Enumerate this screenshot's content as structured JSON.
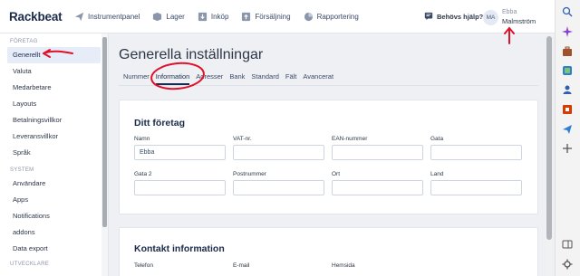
{
  "app": {
    "logo": "Rackbeat"
  },
  "nav": {
    "items": [
      {
        "label": "Instrumentpanel",
        "icon": "paper-plane-icon"
      },
      {
        "label": "Lager",
        "icon": "box-icon"
      },
      {
        "label": "Inköp",
        "icon": "download-icon"
      },
      {
        "label": "Försäljning",
        "icon": "upload-icon"
      },
      {
        "label": "Rapportering",
        "icon": "pie-chart-icon"
      }
    ],
    "help": "Behövs hjälp?",
    "user": {
      "initials": "MA",
      "first_name": "Ebba",
      "last_name": "Malmström"
    }
  },
  "sidebar": {
    "section_company": "FÖRETAG",
    "company_items": [
      "Generellt",
      "Valuta",
      "Medarbetare",
      "Layouts",
      "Betalningsvillkor",
      "Leveransvillkor",
      "Språk"
    ],
    "section_system": "SYSTEM",
    "system_items": [
      "Användare",
      "Apps",
      "Notifications",
      "addons",
      "Data export"
    ],
    "section_dev": "UTVECKLARE"
  },
  "page": {
    "title": "Generella inställningar",
    "tabs": [
      "Nummer",
      "Information",
      "Adresser",
      "Bank",
      "Standard",
      "Fält",
      "Avancerat"
    ],
    "active_tab": "Information"
  },
  "company_card": {
    "title": "Ditt företag",
    "fields": [
      {
        "label": "Namn",
        "value": "Ebba"
      },
      {
        "label": "VAT-nr.",
        "value": ""
      },
      {
        "label": "EAN-nummer",
        "value": ""
      },
      {
        "label": "Gata",
        "value": ""
      },
      {
        "label": "Gata 2",
        "value": ""
      },
      {
        "label": "Postnummer",
        "value": ""
      },
      {
        "label": "Ort",
        "value": ""
      },
      {
        "label": "Land",
        "value": ""
      }
    ]
  },
  "contact_card": {
    "title": "Kontakt information",
    "fields": [
      "Telefon",
      "E-mail",
      "Hemsida"
    ]
  },
  "colors": {
    "accent": "#1b2b4b",
    "annotation": "#e0102a"
  }
}
